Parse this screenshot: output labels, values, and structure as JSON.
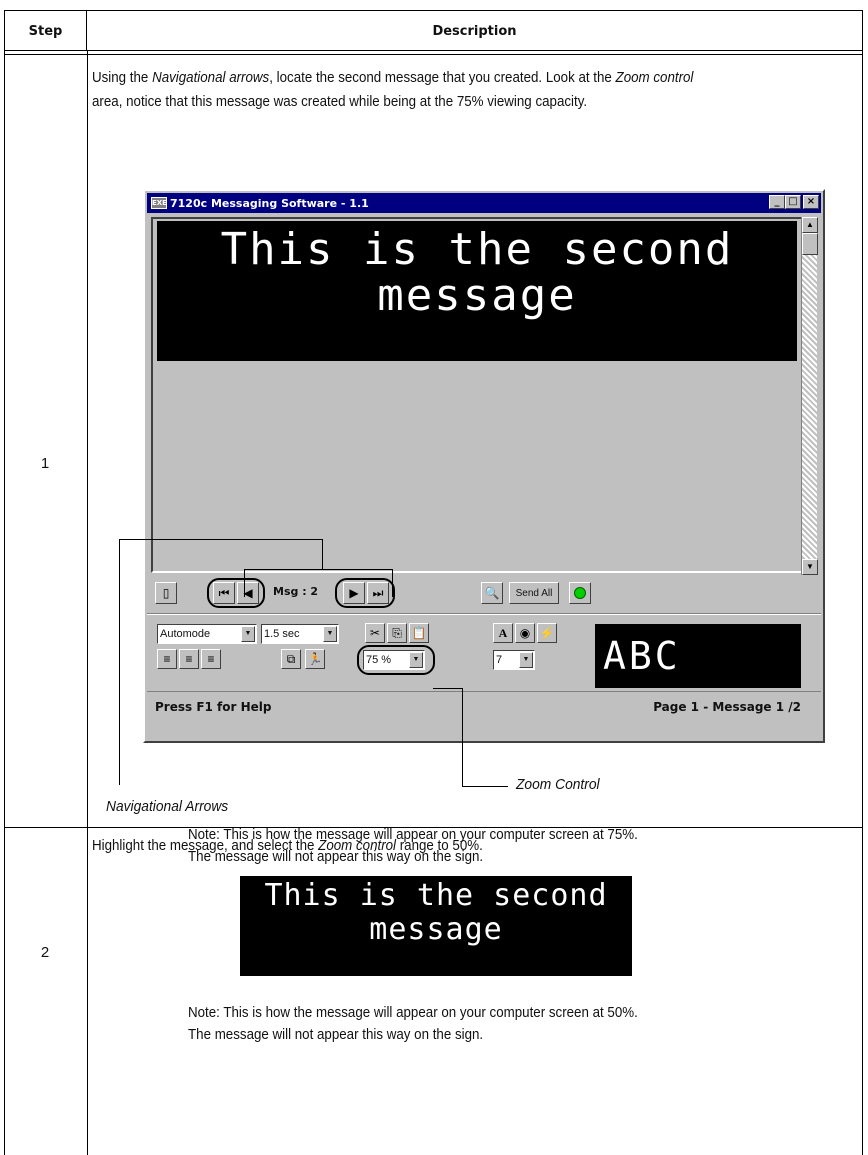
{
  "table": {
    "header_step": "Step",
    "header_description": "Description"
  },
  "row1": {
    "step": "1",
    "intro_line1_part1": "Using the ",
    "intro_line1_italic": "Navigational arrows",
    "intro_line1_part2": ", locate the second message that you created. Look at the ",
    "intro_line1_italic2": "Zoom control",
    "intro_line2": "area, notice that this message was created while being at the 75% viewing capacity.",
    "window": {
      "title": "7120c  Messaging Software - 1.1",
      "app_icon_text": "EXE",
      "minimize": "_",
      "maximize": "□",
      "close": "×",
      "display_line1": "This is the second",
      "display_line2": "message",
      "msg_label": "Msg : 2",
      "send_all": "Send All",
      "mode_select": "Automode",
      "time_select": "1.5 sec",
      "zoom_select": "75 %",
      "size_select": "7",
      "preview_text": "ABC",
      "status_left": "Press F1 for Help",
      "status_right": "Page 1  - Message 1 /2"
    },
    "callout_zoom": "Zoom Control",
    "callout_nav": "Navigational Arrows",
    "note_line1": "Note: This is how the message will appear on your computer screen at 75%.",
    "note_line2": "The message will not appear this way on the sign."
  },
  "row2": {
    "step": "2",
    "intro_part1": "Highlight the message, and select the ",
    "intro_italic": "Zoom control",
    "intro_part2": " range to 50%.",
    "display_line1": "This is the second",
    "display_line2": "message",
    "note_line1": "Note: This is how the message will appear on your computer screen at 50%.",
    "note_line2": "The message will not appear this way on the sign."
  }
}
